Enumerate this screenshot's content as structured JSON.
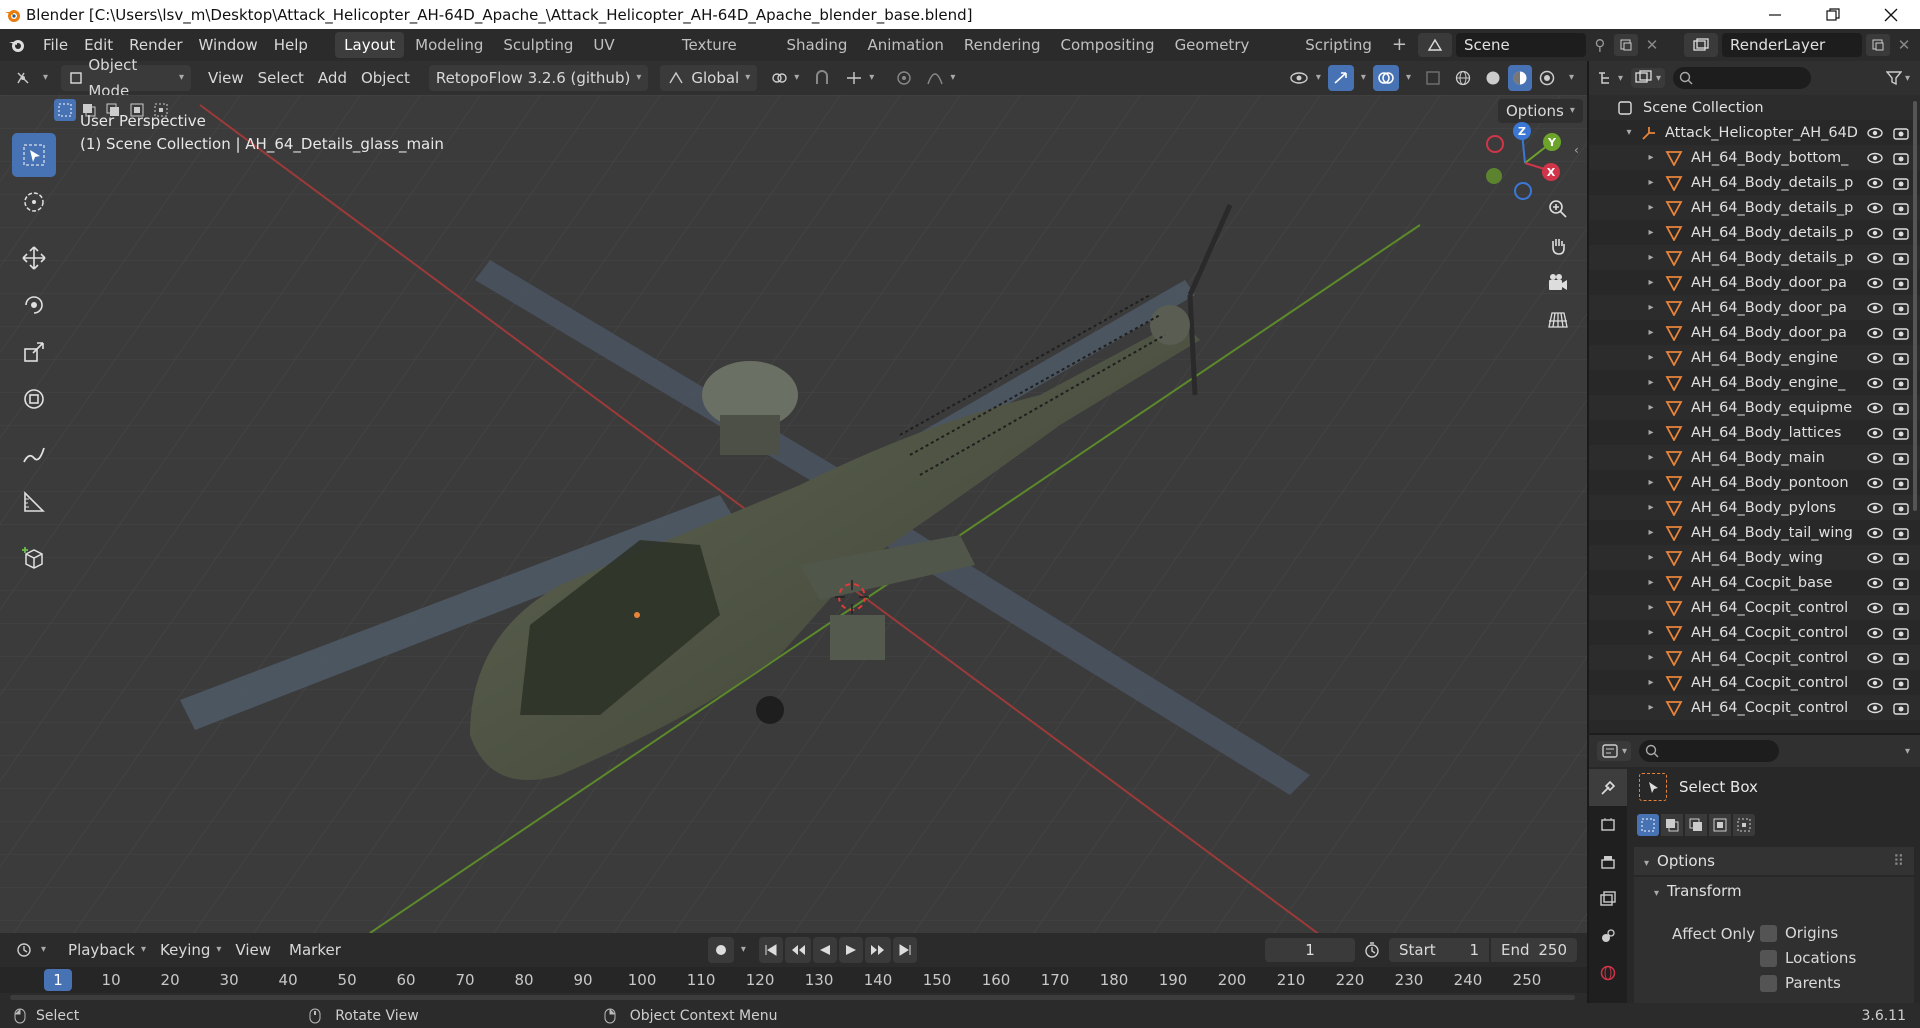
{
  "titlebar": {
    "title": "Blender [C:\\Users\\lsv_m\\Desktop\\Attack_Helicopter_AH-64D_Apache_\\Attack_Helicopter_AH-64D_Apache_blender_base.blend]"
  },
  "menus": [
    "File",
    "Edit",
    "Render",
    "Window",
    "Help"
  ],
  "workspaces": [
    "Layout",
    "Modeling",
    "Sculpting",
    "UV Editing",
    "Texture Paint",
    "Shading",
    "Animation",
    "Rendering",
    "Compositing",
    "Geometry Nodes",
    "Scripting"
  ],
  "active_workspace": "Layout",
  "scene": {
    "name": "Scene"
  },
  "render_layer": {
    "name": "RenderLayer"
  },
  "viewport_header": {
    "mode": "Object Mode",
    "menus": [
      "View",
      "Select",
      "Add",
      "Object"
    ],
    "addon": "RetopoFlow 3.2.6 (github)",
    "orientation": "Global",
    "options": "Options"
  },
  "viewport": {
    "perspective": "User Perspective",
    "collection_info": "(1) Scene Collection | AH_64_Details_glass_main",
    "gizmo": {
      "z": "Z",
      "y": "Y",
      "x": "X"
    }
  },
  "outliner": {
    "root": "Scene Collection",
    "collection": "Attack_Helicopter_AH_64D",
    "items": [
      "AH_64_Body_bottom_",
      "AH_64_Body_details_p",
      "AH_64_Body_details_p",
      "AH_64_Body_details_p",
      "AH_64_Body_details_p",
      "AH_64_Body_door_pa",
      "AH_64_Body_door_pa",
      "AH_64_Body_door_pa",
      "AH_64_Body_engine",
      "AH_64_Body_engine_",
      "AH_64_Body_equipme",
      "AH_64_Body_lattices",
      "AH_64_Body_main",
      "AH_64_Body_pontoon",
      "AH_64_Body_pylons",
      "AH_64_Body_tail_wing",
      "AH_64_Body_wing",
      "AH_64_Cocpit_base",
      "AH_64_Cocpit_control",
      "AH_64_Cocpit_control",
      "AH_64_Cocpit_control",
      "AH_64_Cocpit_control",
      "AH_64_Cocpit_control"
    ]
  },
  "properties": {
    "tool_name": "Select Box",
    "options_label": "Options",
    "transform_label": "Transform",
    "affect_only": "Affect Only",
    "checks": [
      "Origins",
      "Locations",
      "Parents"
    ]
  },
  "timeline": {
    "menus": [
      "Playback",
      "Keying",
      "View",
      "Marker"
    ],
    "current_frame": "1",
    "start_label": "Start",
    "start": "1",
    "end_label": "End",
    "end": "250",
    "ticks": [
      "1",
      "10",
      "20",
      "30",
      "40",
      "50",
      "60",
      "70",
      "80",
      "90",
      "100",
      "110",
      "120",
      "130",
      "140",
      "150",
      "160",
      "170",
      "180",
      "190",
      "200",
      "210",
      "220",
      "230",
      "240",
      "250"
    ]
  },
  "statusbar": {
    "select": "Select",
    "rotate": "Rotate View",
    "context": "Object Context Menu",
    "version": "3.6.11"
  },
  "colors": {
    "accent": "#4772b3",
    "x_axis": "#d0354a",
    "y_axis": "#6ba32b",
    "z_axis": "#3b78d6",
    "orange": "#e8843a"
  }
}
